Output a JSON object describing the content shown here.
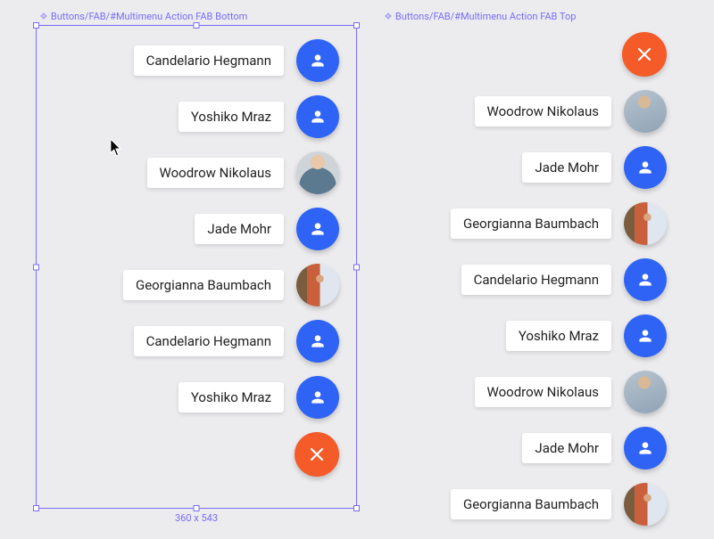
{
  "left": {
    "label": "Buttons/FAB/#Multimenu Action FAB Bottom",
    "dims": "360 x 543",
    "items": [
      {
        "name": "Candelario Hegmann",
        "icon": "person"
      },
      {
        "name": "Yoshiko Mraz",
        "icon": "person"
      },
      {
        "name": "Woodrow Nikolaus",
        "icon": "avatar-man"
      },
      {
        "name": "Jade Mohr",
        "icon": "person"
      },
      {
        "name": "Georgianna Baumbach",
        "icon": "avatar-woman"
      },
      {
        "name": "Candelario Hegmann",
        "icon": "person"
      },
      {
        "name": "Yoshiko Mraz",
        "icon": "person"
      }
    ]
  },
  "right": {
    "label": "Buttons/FAB/#Multimenu Action FAB Top",
    "items": [
      {
        "name": "Woodrow Nikolaus",
        "icon": "avatar-man2"
      },
      {
        "name": "Jade Mohr",
        "icon": "person"
      },
      {
        "name": "Georgianna Baumbach",
        "icon": "avatar-woman"
      },
      {
        "name": "Candelario Hegmann",
        "icon": "person"
      },
      {
        "name": "Yoshiko Mraz",
        "icon": "person"
      },
      {
        "name": "Woodrow Nikolaus",
        "icon": "avatar-man2"
      },
      {
        "name": "Jade Mohr",
        "icon": "person"
      },
      {
        "name": "Georgianna Baumbach",
        "icon": "avatar-woman"
      }
    ]
  },
  "colors": {
    "blue": "#2e63f6",
    "orange": "#f55a29",
    "selection": "#7a6bff"
  }
}
